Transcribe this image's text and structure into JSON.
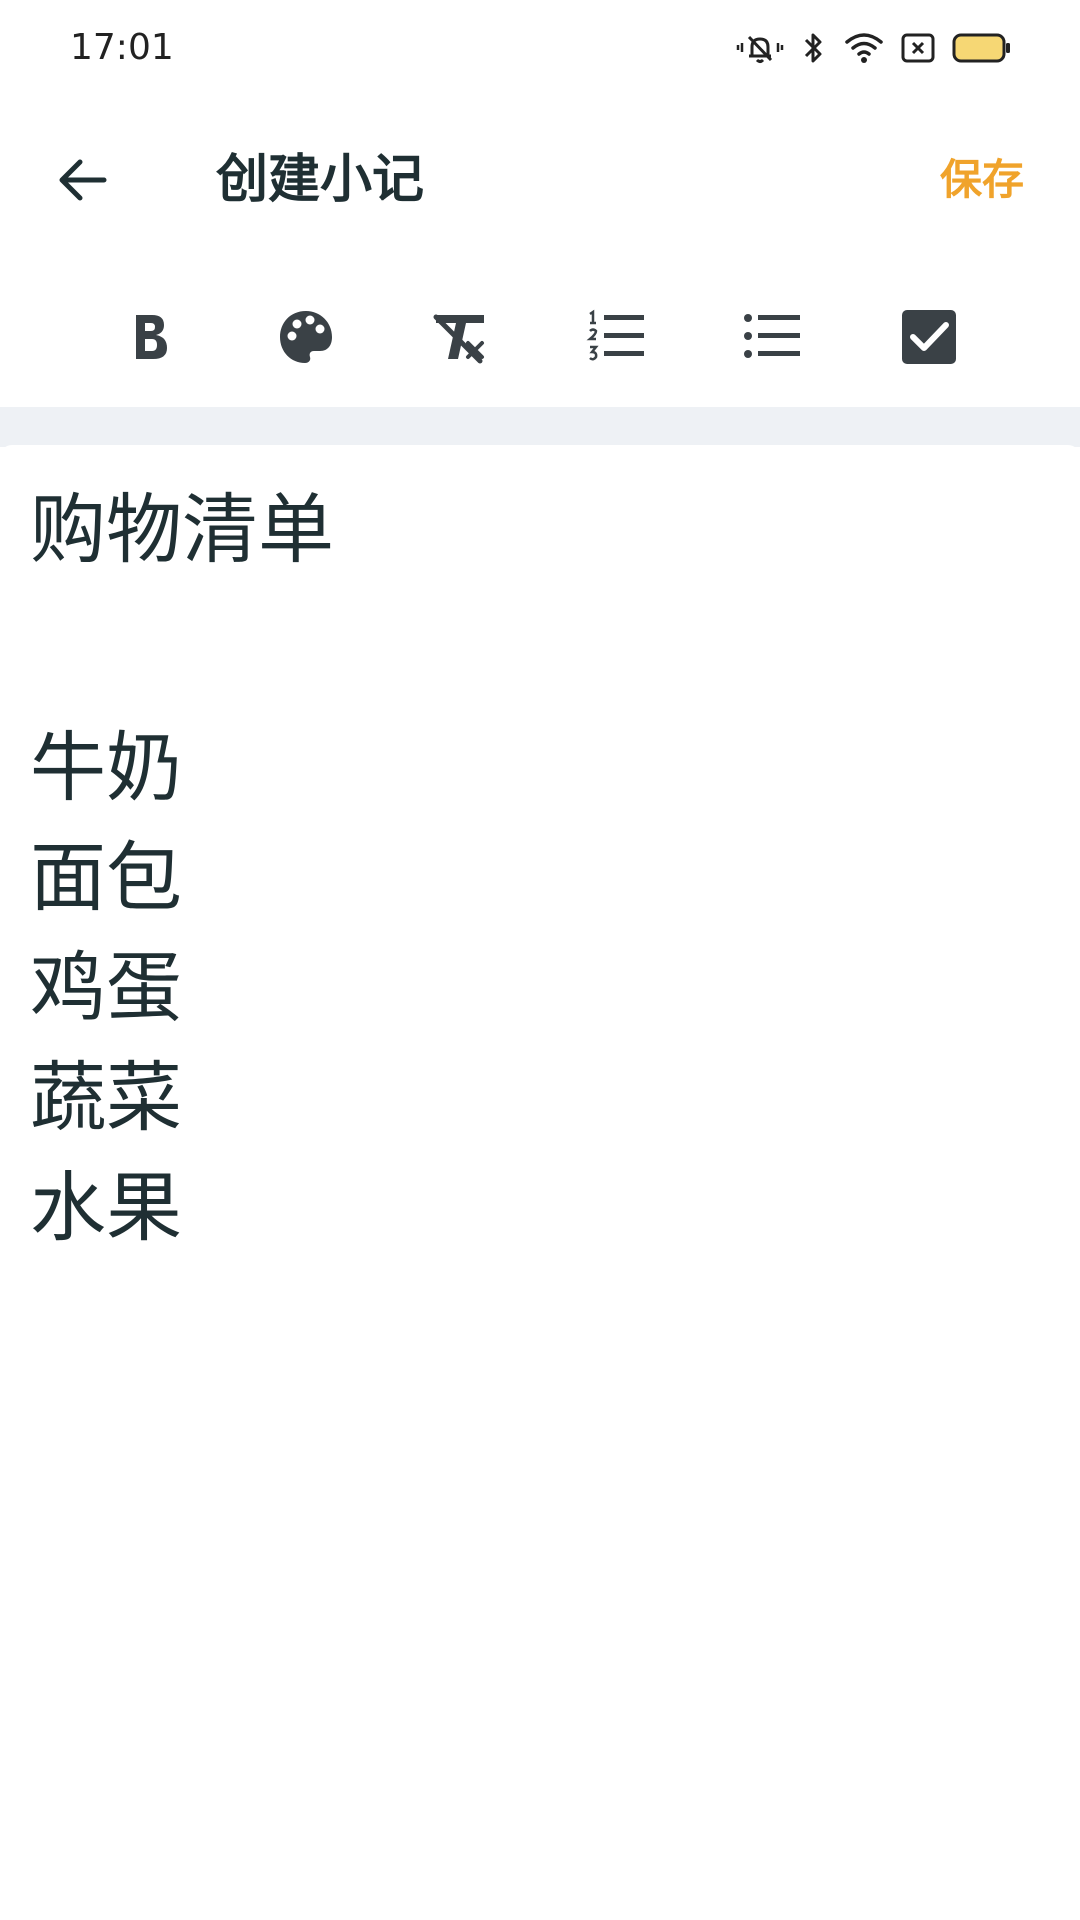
{
  "status_bar": {
    "time": "17:01",
    "icons": [
      "mute-vibrate-icon",
      "bluetooth-icon",
      "wifi-icon",
      "no-sim-icon",
      "battery-icon"
    ]
  },
  "app_bar": {
    "back_icon": "arrow-left-icon",
    "title": "创建小记",
    "save_label": "保存"
  },
  "toolbar": {
    "tools": [
      "bold-icon",
      "palette-icon",
      "clear-format-icon",
      "numbered-list-icon",
      "bulleted-list-icon",
      "checkbox-icon"
    ]
  },
  "note": {
    "title": "购物清单",
    "items": [
      "牛奶",
      "面包",
      "鸡蛋",
      "蔬菜",
      "水果"
    ]
  },
  "colors": {
    "accent": "#f0a32b",
    "text": "#1f2f33",
    "icon": "#3a4146",
    "divider": "#eef1f5",
    "battery": "#f6d774"
  }
}
